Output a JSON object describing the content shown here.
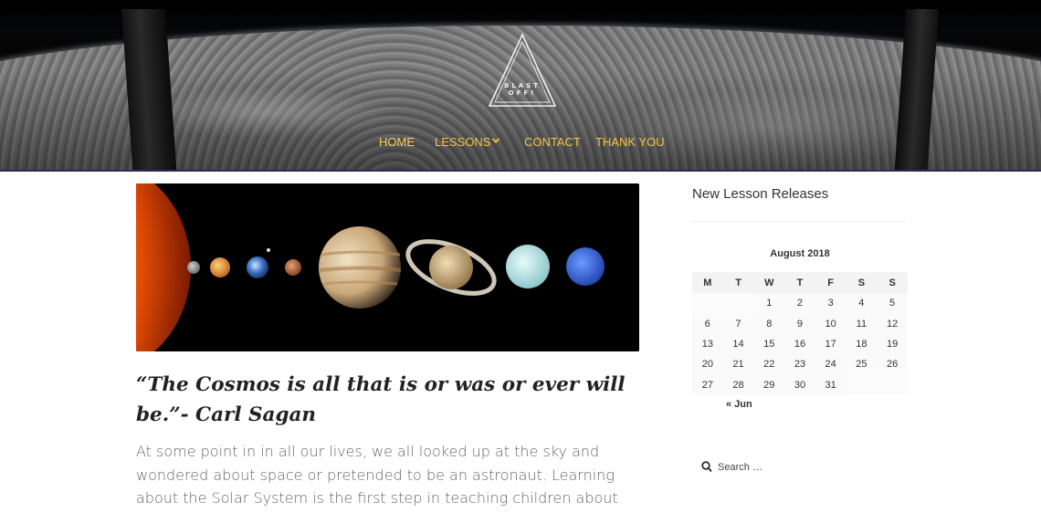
{
  "header": {
    "logo_text": "BLAST OFF!",
    "nav": [
      {
        "label": "HOME"
      },
      {
        "label": "LESSONS"
      },
      {
        "label": "CONTACT"
      },
      {
        "label": "THANK YOU"
      }
    ],
    "nav_color": "#f6c343"
  },
  "main": {
    "quote": "“The Cosmos is all that is or was or ever will be.”- Carl Sagan",
    "body": "At some point in in all our lives, we all looked up at the sky and wondered about space or pretended to be an astronaut.  Learning about the Solar System is the first step in teaching children about how vast space really is."
  },
  "sidebar": {
    "widget_title": "New Lesson Releases",
    "calendar": {
      "caption": "August 2018",
      "weekdays": [
        "M",
        "T",
        "W",
        "T",
        "F",
        "S",
        "S"
      ],
      "weeks": [
        [
          "",
          "",
          "1",
          "2",
          "3",
          "4",
          "5"
        ],
        [
          "6",
          "7",
          "8",
          "9",
          "10",
          "11",
          "12"
        ],
        [
          "13",
          "14",
          "15",
          "16",
          "17",
          "18",
          "19"
        ],
        [
          "20",
          "21",
          "22",
          "23",
          "24",
          "25",
          "26"
        ],
        [
          "27",
          "28",
          "29",
          "30",
          "31",
          "",
          ""
        ]
      ],
      "prev_link": "« Jun"
    },
    "search": {
      "placeholder": "Search …",
      "icon": "search-icon"
    }
  }
}
